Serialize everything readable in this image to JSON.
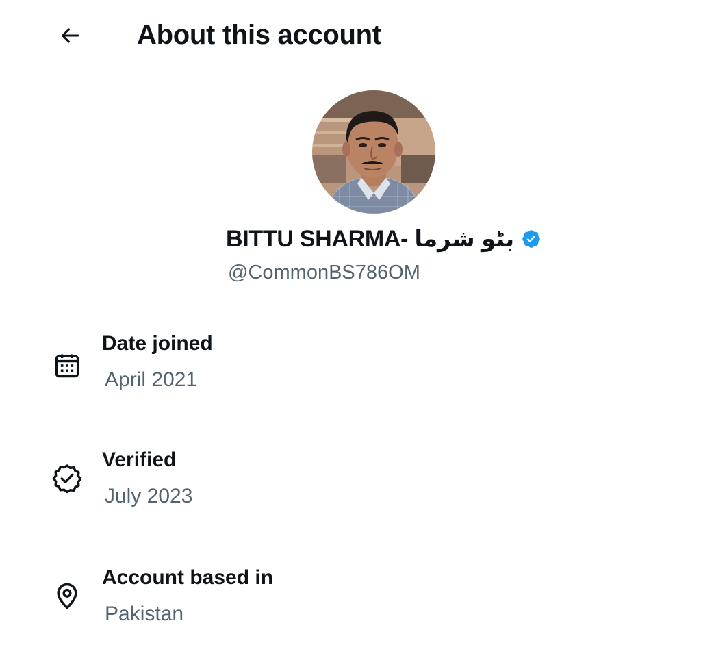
{
  "header": {
    "title": "About this account",
    "back_icon": "arrow-left-icon"
  },
  "profile": {
    "display_name": "BITTU SHARMA- بٹو شرما",
    "handle": "@CommonBS786OM",
    "verified_badge_color": "#1d9bf0",
    "verified_icon": "verified-badge-icon"
  },
  "info": {
    "date_joined": {
      "label": "Date joined",
      "value": "April 2021",
      "icon": "calendar-icon"
    },
    "verified": {
      "label": "Verified",
      "value": "July 2023",
      "icon": "verified-outline-icon"
    },
    "account_based_in": {
      "label": "Account based in",
      "value": "Pakistan",
      "icon": "location-pin-icon"
    }
  }
}
